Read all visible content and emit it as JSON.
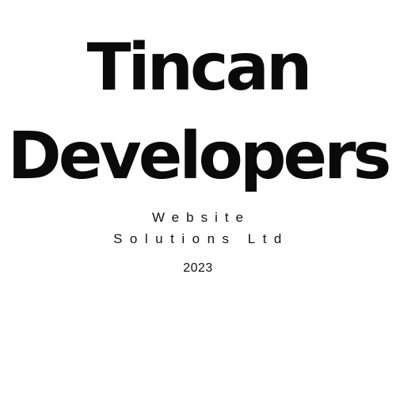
{
  "logo": {
    "title_line_1": "Tincan",
    "title_line_2": "Developers",
    "tagline_line_1": "Website",
    "tagline_line_2": "Solutions Ltd",
    "year": "2023"
  },
  "colors": {
    "background": "#ffffff",
    "text": "#0a0a0a"
  }
}
